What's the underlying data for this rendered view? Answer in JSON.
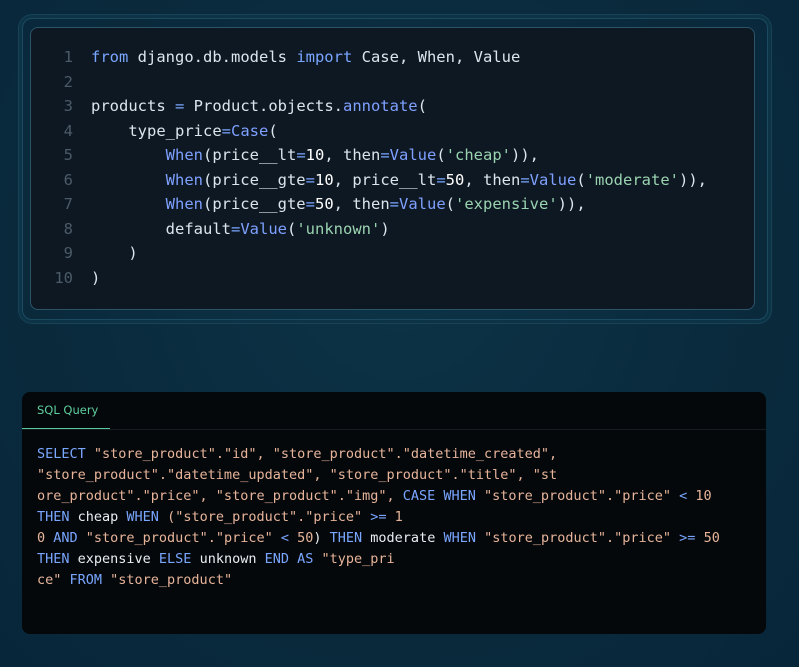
{
  "code_panel": {
    "lines": [
      {
        "n": "1",
        "tokens": [
          {
            "t": "from ",
            "c": "kw"
          },
          {
            "t": "django.db.models ",
            "c": "pl"
          },
          {
            "t": "import ",
            "c": "kw"
          },
          {
            "t": "Case, When, Value",
            "c": "pl"
          }
        ]
      },
      {
        "n": "2",
        "tokens": []
      },
      {
        "n": "3",
        "tokens": [
          {
            "t": "products ",
            "c": "pl"
          },
          {
            "t": "= ",
            "c": "eq"
          },
          {
            "t": "Product.objects.",
            "c": "pl"
          },
          {
            "t": "annotate",
            "c": "fn"
          },
          {
            "t": "(",
            "c": "pl"
          }
        ]
      },
      {
        "n": "4",
        "tokens": [
          {
            "t": "    type_price",
            "c": "pl"
          },
          {
            "t": "=",
            "c": "eq"
          },
          {
            "t": "Case",
            "c": "fn"
          },
          {
            "t": "(",
            "c": "pl"
          }
        ]
      },
      {
        "n": "5",
        "tokens": [
          {
            "t": "        ",
            "c": "pl"
          },
          {
            "t": "When",
            "c": "fn"
          },
          {
            "t": "(price__lt",
            "c": "pl"
          },
          {
            "t": "=",
            "c": "eq"
          },
          {
            "t": "10",
            "c": "num"
          },
          {
            "t": ", then",
            "c": "pl"
          },
          {
            "t": "=",
            "c": "eq"
          },
          {
            "t": "Value",
            "c": "fn"
          },
          {
            "t": "(",
            "c": "pl"
          },
          {
            "t": "'cheap'",
            "c": "str"
          },
          {
            "t": ")),",
            "c": "pl"
          }
        ]
      },
      {
        "n": "6",
        "tokens": [
          {
            "t": "        ",
            "c": "pl"
          },
          {
            "t": "When",
            "c": "fn"
          },
          {
            "t": "(price__gte",
            "c": "pl"
          },
          {
            "t": "=",
            "c": "eq"
          },
          {
            "t": "10",
            "c": "num"
          },
          {
            "t": ", price__lt",
            "c": "pl"
          },
          {
            "t": "=",
            "c": "eq"
          },
          {
            "t": "50",
            "c": "num"
          },
          {
            "t": ", then",
            "c": "pl"
          },
          {
            "t": "=",
            "c": "eq"
          },
          {
            "t": "Value",
            "c": "fn"
          },
          {
            "t": "(",
            "c": "pl"
          },
          {
            "t": "'moderate'",
            "c": "str"
          },
          {
            "t": ")),",
            "c": "pl"
          }
        ]
      },
      {
        "n": "7",
        "tokens": [
          {
            "t": "        ",
            "c": "pl"
          },
          {
            "t": "When",
            "c": "fn"
          },
          {
            "t": "(price__gte",
            "c": "pl"
          },
          {
            "t": "=",
            "c": "eq"
          },
          {
            "t": "50",
            "c": "num"
          },
          {
            "t": ", then",
            "c": "pl"
          },
          {
            "t": "=",
            "c": "eq"
          },
          {
            "t": "Value",
            "c": "fn"
          },
          {
            "t": "(",
            "c": "pl"
          },
          {
            "t": "'expensive'",
            "c": "str"
          },
          {
            "t": ")),",
            "c": "pl"
          }
        ]
      },
      {
        "n": "8",
        "tokens": [
          {
            "t": "        default",
            "c": "pl"
          },
          {
            "t": "=",
            "c": "eq"
          },
          {
            "t": "Value",
            "c": "fn"
          },
          {
            "t": "(",
            "c": "pl"
          },
          {
            "t": "'unknown'",
            "c": "str"
          },
          {
            "t": ")",
            "c": "pl"
          }
        ]
      },
      {
        "n": "9",
        "tokens": [
          {
            "t": "    )",
            "c": "pl"
          }
        ]
      },
      {
        "n": "10",
        "tokens": [
          {
            "t": ")",
            "c": "pl"
          }
        ]
      }
    ]
  },
  "sql_panel": {
    "tab_label": "SQL Query",
    "lines": [
      [
        {
          "t": "SELECT ",
          "c": "sk"
        },
        {
          "t": "\"store_product\".\"id\", \"store_product\".\"datetime_created\",",
          "c": "ss"
        }
      ],
      [
        {
          "t": "\"store_product\".\"datetime_updated\", \"store_product\".\"title\", \"st",
          "c": "ss"
        }
      ],
      [
        {
          "t": "ore_product\".\"price\", \"store_product\".\"img\", ",
          "c": "ss"
        },
        {
          "t": "CASE WHEN ",
          "c": "sk"
        },
        {
          "t": "\"store_product\".\"price\" ",
          "c": "ss"
        },
        {
          "t": "< ",
          "c": "sk"
        },
        {
          "t": "10",
          "c": "sn"
        }
      ],
      [
        {
          "t": "THEN ",
          "c": "sk"
        },
        {
          "t": "cheap ",
          "c": "sp"
        },
        {
          "t": "WHEN ",
          "c": "sk"
        },
        {
          "t": "(\"store_product\".\"price\" ",
          "c": "ss"
        },
        {
          "t": ">= ",
          "c": "sk"
        },
        {
          "t": "1",
          "c": "sn"
        }
      ],
      [
        {
          "t": "0 ",
          "c": "sn"
        },
        {
          "t": "AND ",
          "c": "sk"
        },
        {
          "t": "\"store_product\".\"price\" ",
          "c": "ss"
        },
        {
          "t": "< ",
          "c": "sk"
        },
        {
          "t": "50",
          "c": "sn"
        },
        {
          "t": ") ",
          "c": "sp"
        },
        {
          "t": "THEN ",
          "c": "sk"
        },
        {
          "t": "moderate ",
          "c": "sp"
        },
        {
          "t": "WHEN ",
          "c": "sk"
        },
        {
          "t": "\"store_product\".\"price\" ",
          "c": "ss"
        },
        {
          "t": ">= ",
          "c": "sk"
        },
        {
          "t": "50",
          "c": "sn"
        }
      ],
      [
        {
          "t": "THEN ",
          "c": "sk"
        },
        {
          "t": "expensive ",
          "c": "sp"
        },
        {
          "t": "ELSE ",
          "c": "sk"
        },
        {
          "t": "unknown ",
          "c": "sp"
        },
        {
          "t": "END AS ",
          "c": "sk"
        },
        {
          "t": "\"type_pri",
          "c": "ss"
        }
      ],
      [
        {
          "t": "ce\" ",
          "c": "ss"
        },
        {
          "t": "FROM ",
          "c": "sk"
        },
        {
          "t": "\"store_product\"",
          "c": "ss"
        }
      ]
    ]
  },
  "colors": {
    "background": "#0a2b3d",
    "code_bg": "#0e1823",
    "sql_bg": "#05080b",
    "keyword": "#79a6ff",
    "string_code": "#9ad3b0",
    "string_sql": "#e7b49a",
    "tab_accent": "#5ecf9f"
  }
}
